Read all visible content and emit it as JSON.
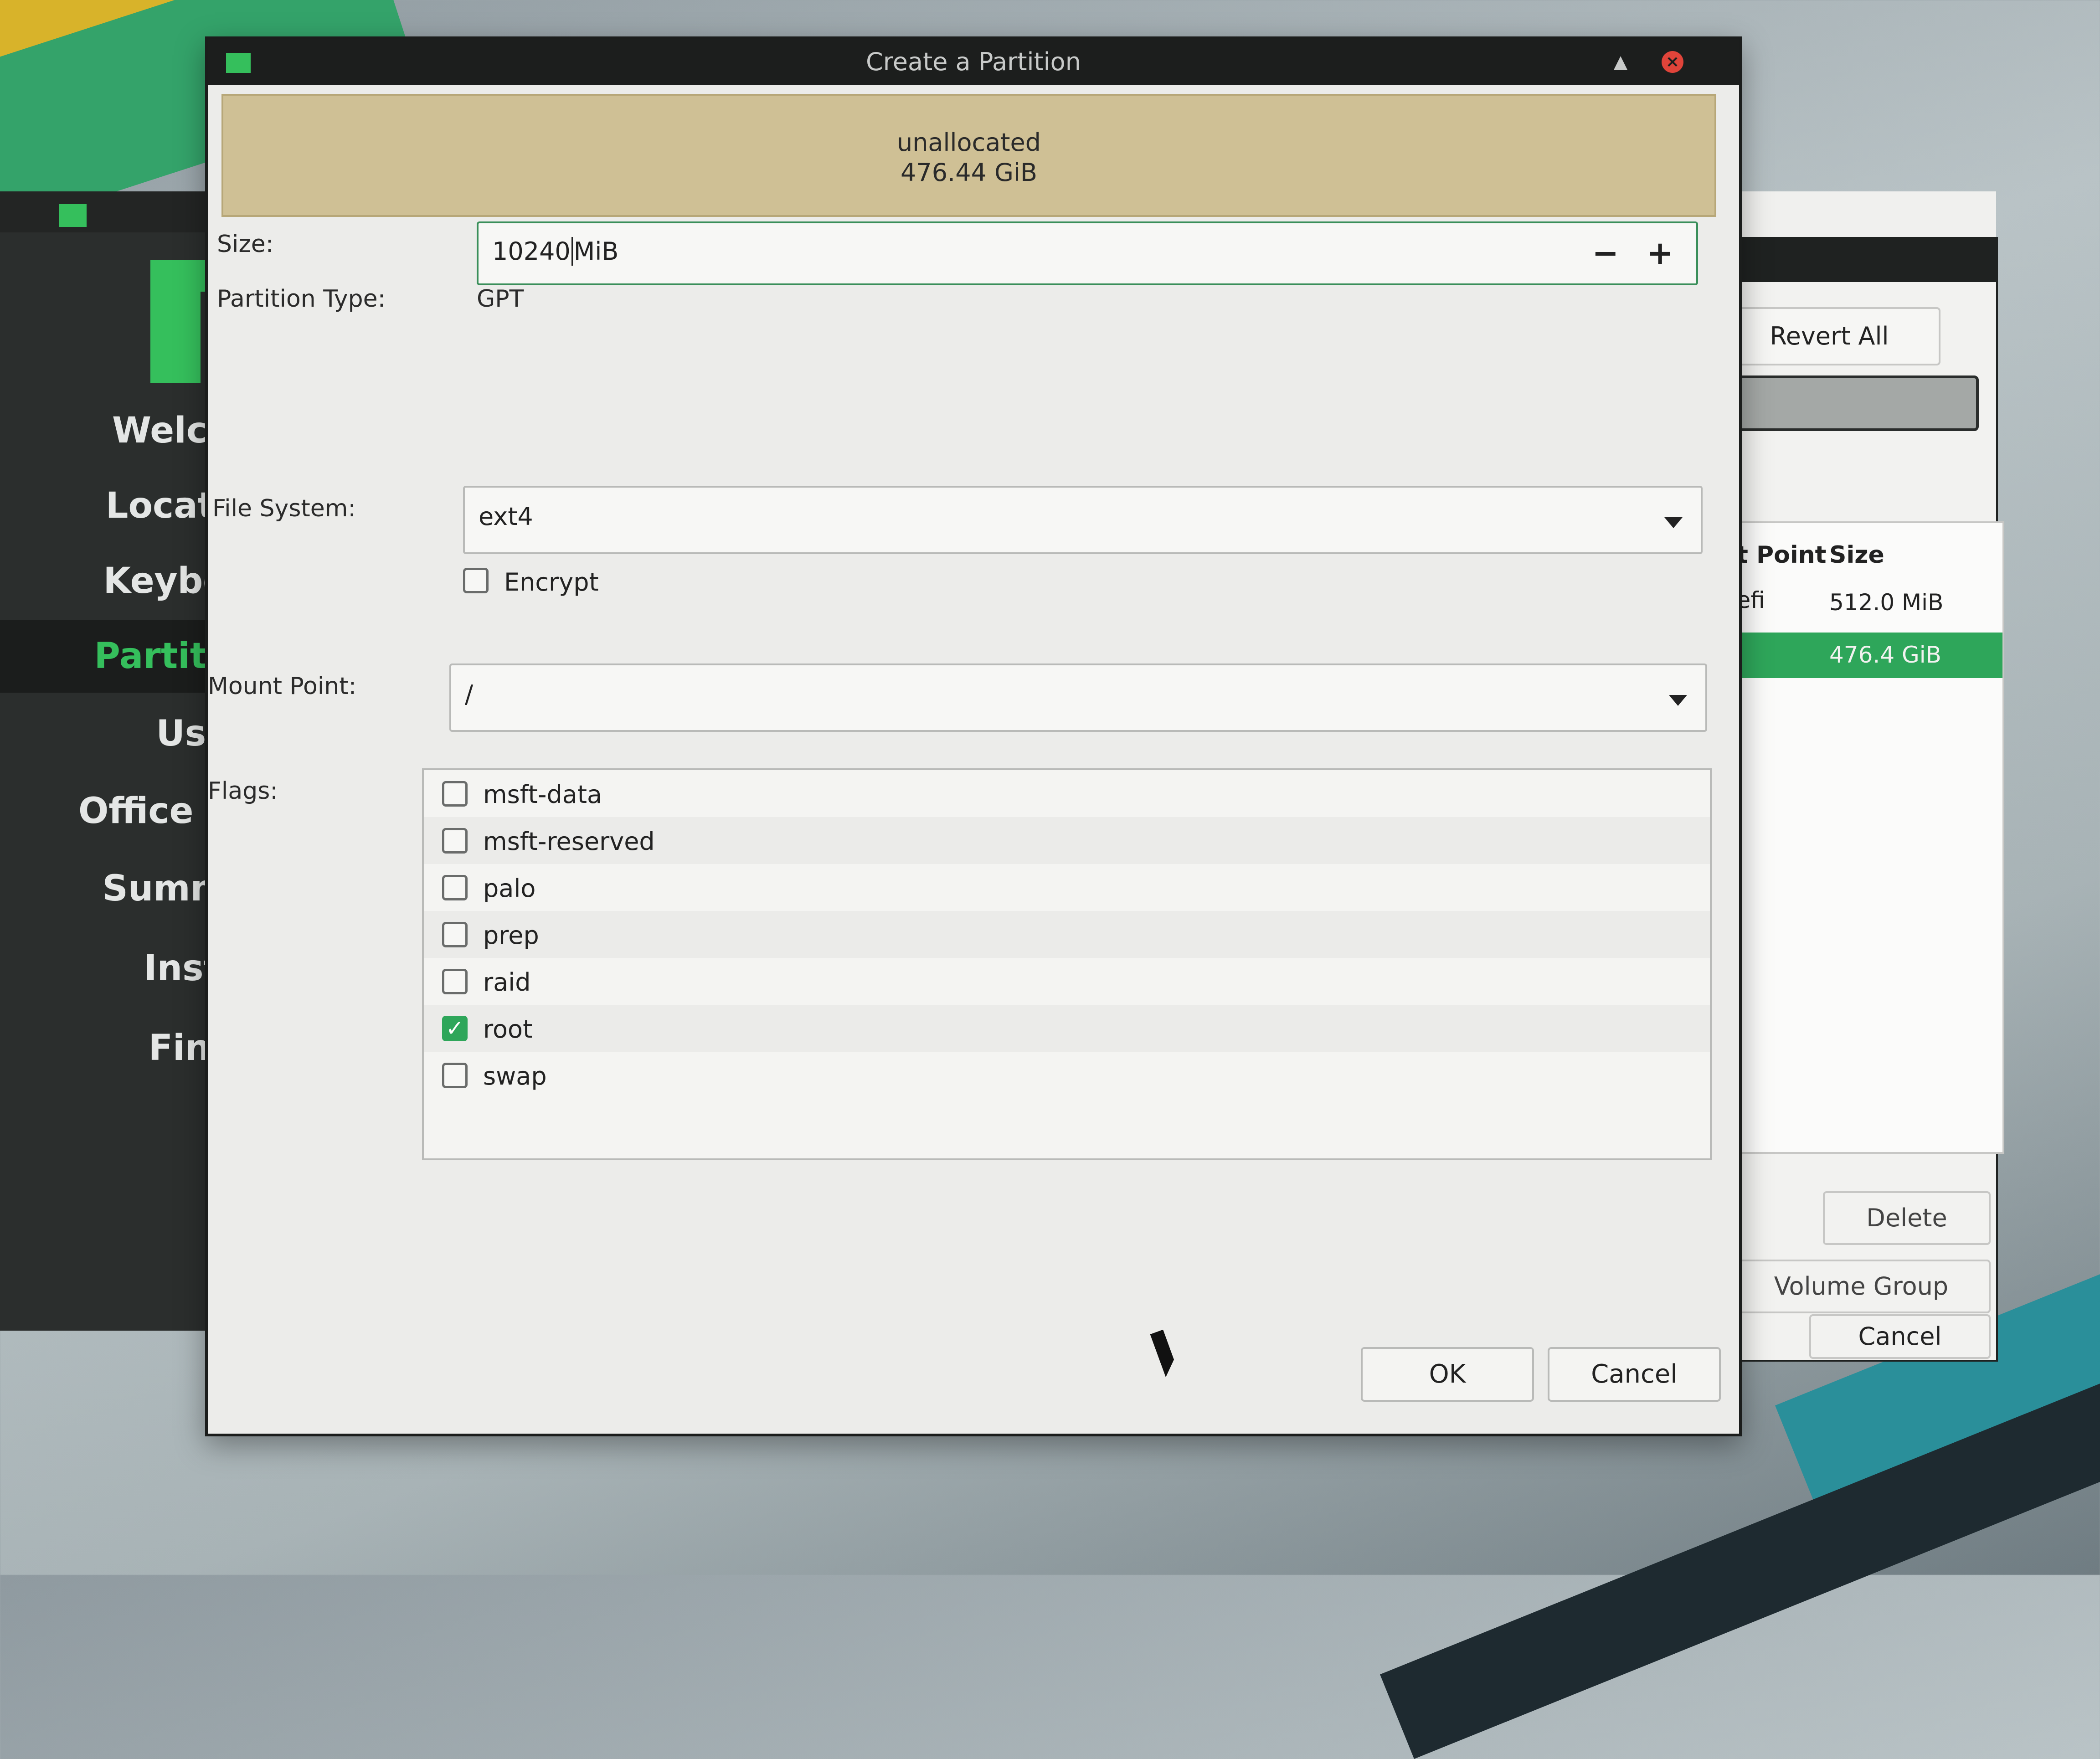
{
  "installer": {
    "nav": [
      {
        "label": "Welcom"
      },
      {
        "label": "Locatior"
      },
      {
        "label": "Keyboar"
      },
      {
        "label": "Partition"
      },
      {
        "label": "Users"
      },
      {
        "label": "Office Sui"
      },
      {
        "label": "Summar"
      },
      {
        "label": "Install"
      },
      {
        "label": "Finish"
      }
    ],
    "accent": "#35bf5c"
  },
  "partition_window": {
    "revert_label": "Revert All Changes",
    "columns": {
      "mount": "nt Point",
      "size": "Size"
    },
    "rows": [
      {
        "mount": "t/efi",
        "size": "512.0 MiB"
      },
      {
        "mount": "",
        "size": "476.4 GiB"
      }
    ],
    "delete_label": "Delete",
    "volume_group_label": "Volume Group",
    "cancel_label": "Cancel"
  },
  "dialog": {
    "title": "Create a Partition",
    "unallocated": {
      "name": "unallocated",
      "size": "476.44 GiB"
    },
    "size": {
      "label": "Size:",
      "value": "10240",
      "unit": "MiB"
    },
    "partition_type": {
      "label": "Partition Type:",
      "value": "GPT"
    },
    "file_system": {
      "label": "File System:",
      "value": "ext4"
    },
    "encrypt": {
      "label": "Encrypt",
      "checked": false
    },
    "mount_point": {
      "label": "Mount Point:",
      "value": "/"
    },
    "flags": {
      "label": "Flags:",
      "items": [
        {
          "name": "msft-data",
          "checked": false
        },
        {
          "name": "msft-reserved",
          "checked": false
        },
        {
          "name": "palo",
          "checked": false
        },
        {
          "name": "prep",
          "checked": false
        },
        {
          "name": "raid",
          "checked": false
        },
        {
          "name": "root",
          "checked": true
        },
        {
          "name": "swap",
          "checked": false
        }
      ]
    },
    "ok_label": "OK",
    "cancel_label": "Cancel"
  }
}
